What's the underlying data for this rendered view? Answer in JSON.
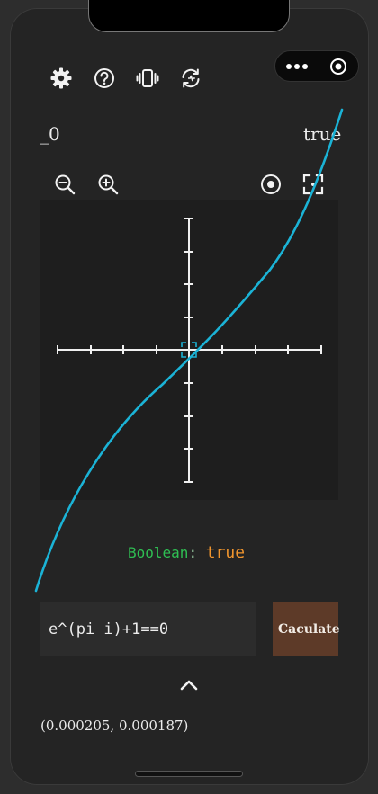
{
  "toolbar": {
    "icons": [
      "gear-icon",
      "help-icon",
      "vibrate-icon",
      "sync-icon"
    ]
  },
  "capsule": {
    "icons": [
      "more-icon",
      "target-icon"
    ]
  },
  "readouts": {
    "left": "_0",
    "right": "true"
  },
  "graph": {
    "controls": [
      "zoom-out-icon",
      "zoom-in-icon",
      "center-icon",
      "fullscreen-icon"
    ],
    "accent_color": "#1bb3d6",
    "axis_color": "#f0f0f0"
  },
  "result": {
    "key": "Boolean",
    "separator": ":",
    "value": "true",
    "key_color": "#2fbf53",
    "value_color": "#f0952e"
  },
  "expression": {
    "value": "e^(pi i)+1==0"
  },
  "calculate_button": {
    "label": "Caculate",
    "color": "#5d3a28"
  },
  "coords": {
    "text": "(0.000205, 0.000187)"
  }
}
